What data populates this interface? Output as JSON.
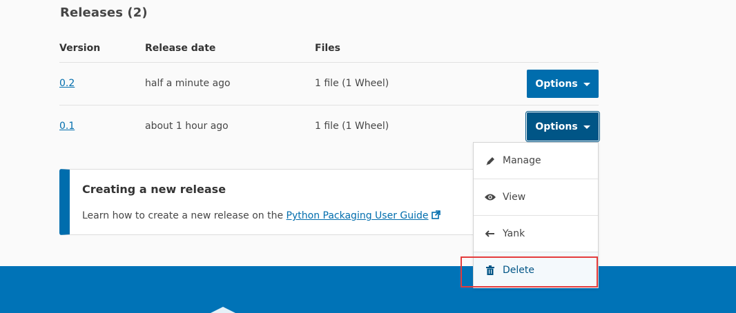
{
  "page": {
    "title": "Releases (2)"
  },
  "table": {
    "headers": {
      "version": "Version",
      "date": "Release date",
      "files": "Files"
    },
    "rows": [
      {
        "version": "0.2",
        "date": "half a minute ago",
        "files": "1 file (1 Wheel)",
        "options_label": "Options"
      },
      {
        "version": "0.1",
        "date": "about 1 hour ago",
        "files": "1 file (1 Wheel)",
        "options_label": "Options"
      }
    ]
  },
  "dropdown": {
    "items": [
      {
        "label": "Manage",
        "icon": "pencil-icon"
      },
      {
        "label": "View",
        "icon": "eye-icon"
      },
      {
        "label": "Yank",
        "icon": "arrow-left-icon"
      },
      {
        "label": "Delete",
        "icon": "trash-icon"
      }
    ]
  },
  "callout": {
    "title": "Creating a new release",
    "body_prefix": "Learn how to create a new release on the ",
    "link_text": "Python Packaging User Guide"
  },
  "colors": {
    "accent": "#006dad",
    "accent_dark": "#005586",
    "footer": "#0073b7",
    "highlight": "#e43b3b"
  }
}
